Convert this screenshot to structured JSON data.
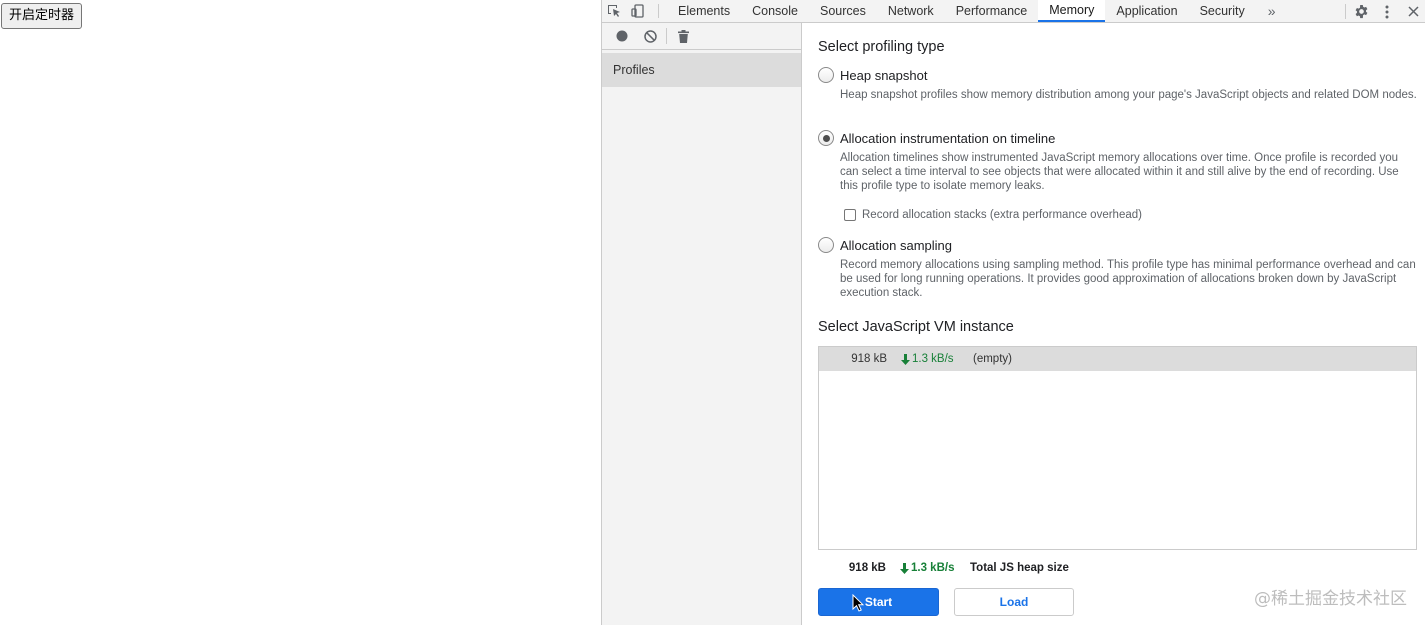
{
  "page": {
    "button_label": "开启定时器"
  },
  "devtools": {
    "tabs": [
      {
        "label": "Elements"
      },
      {
        "label": "Console"
      },
      {
        "label": "Sources"
      },
      {
        "label": "Network"
      },
      {
        "label": "Performance"
      },
      {
        "label": "Memory"
      },
      {
        "label": "Application"
      },
      {
        "label": "Security"
      }
    ],
    "active_tab": "Memory",
    "more_tabs": "»",
    "sidebar": {
      "profiles_label": "Profiles"
    },
    "profiling": {
      "title": "Select profiling type",
      "selected": "Allocation instrumentation on timeline",
      "options": [
        {
          "label": "Heap snapshot",
          "desc": "Heap snapshot profiles show memory distribution among your page's JavaScript objects and related DOM nodes."
        },
        {
          "label": "Allocation instrumentation on timeline",
          "desc": "Allocation timelines show instrumented JavaScript memory allocations over time. Once profile is recorded you can select a time interval to see objects that were allocated within it and still alive by the end of recording. Use this profile type to isolate memory leaks."
        },
        {
          "label": "Allocation sampling",
          "desc": "Record memory allocations using sampling method. This profile type has minimal performance overhead and can be used for long running operations. It provides good approximation of allocations broken down by JavaScript execution stack."
        }
      ],
      "record_stacks_label": "Record allocation stacks (extra performance overhead)",
      "record_stacks_checked": false
    },
    "vm": {
      "title": "Select JavaScript VM instance",
      "rows": [
        {
          "size": "918 kB",
          "rate": "1.3 kB/s",
          "name": "(empty)"
        }
      ],
      "summary": {
        "size": "918 kB",
        "rate": "1.3 kB/s",
        "label": "Total JS heap size"
      }
    },
    "buttons": {
      "start": "Start",
      "load": "Load"
    },
    "colors": {
      "accent": "#1a73e8",
      "rate_green": "#188038"
    }
  },
  "watermark": "@稀土掘金技术社区"
}
